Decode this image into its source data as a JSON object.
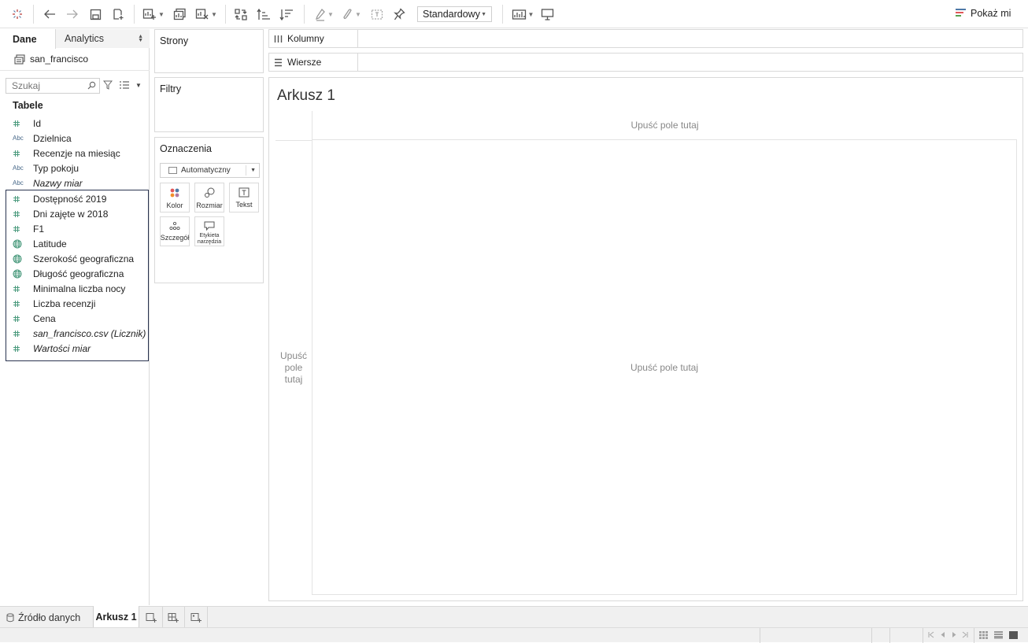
{
  "toolbar": {
    "format_value": "Standardowy",
    "show_me_label": "Pokaż mi",
    "icons": [
      "tableau-logo-icon",
      "undo-icon",
      "redo-icon",
      "save-icon",
      "new-datasource-icon",
      "new-worksheet-icon",
      "duplicate-icon",
      "clear-sheet-icon",
      "swap-icon",
      "sort-ascending-icon",
      "sort-descending-icon",
      "highlight-icon",
      "group-icon",
      "labels-icon",
      "pin-icon",
      "fit-icon",
      "presentation-icon",
      "show-me-icon"
    ]
  },
  "data_pane": {
    "tab_data": "Dane",
    "tab_analytics": "Analytics",
    "datasource_name": "san_francisco",
    "search_placeholder": "Szukaj",
    "tables_heading": "Tabele",
    "dimensions": [
      {
        "type": "number",
        "label": "Id"
      },
      {
        "type": "string",
        "label": "Dzielnica"
      },
      {
        "type": "number",
        "label": "Recenzje na miesiąc"
      },
      {
        "type": "string",
        "label": "Typ pokoju"
      },
      {
        "type": "string",
        "label": "Nazwy miar",
        "italic": true
      }
    ],
    "measures": [
      {
        "type": "number",
        "label": "Dostępność 2019"
      },
      {
        "type": "number",
        "label": "Dni zajęte w 2018"
      },
      {
        "type": "number",
        "label": "F1"
      },
      {
        "type": "geo",
        "label": "Latitude"
      },
      {
        "type": "geo",
        "label": "Szerokość geograficzna"
      },
      {
        "type": "geo",
        "label": "Długość geograficzna"
      },
      {
        "type": "number",
        "label": "Minimalna liczba nocy"
      },
      {
        "type": "number",
        "label": "Liczba recenzji"
      },
      {
        "type": "number",
        "label": "Cena"
      },
      {
        "type": "number",
        "label": "san_francisco.csv (Licznik)",
        "italic": true
      },
      {
        "type": "number",
        "label": "Wartości miar",
        "italic": true
      }
    ],
    "abc_glyph": "Abc"
  },
  "cards": {
    "pages_title": "Strony",
    "filters_title": "Filtry",
    "marks_title": "Oznaczenia",
    "marks_type": "Automatyczny",
    "marks_buttons": {
      "color": "Kolor",
      "size": "Rozmiar",
      "text": "Tekst",
      "detail": "Szczegół",
      "tooltip_line1": "Etykieta",
      "tooltip_line2": "narzędzia"
    }
  },
  "shelves": {
    "columns_label": "Kolumny",
    "rows_label": "Wiersze"
  },
  "view": {
    "sheet_title": "Arkusz 1",
    "drop_top": "Upuść pole tutaj",
    "drop_left_1": "Upuść",
    "drop_left_2": "pole",
    "drop_left_3": "tutaj",
    "drop_main": "Upuść pole tutaj"
  },
  "sheet_tabs": {
    "data_source_label": "Źródło danych",
    "active_sheet": "Arkusz 1"
  },
  "colors": {
    "accent_green": "#4a9a7d",
    "measures_highlight": "#2a3450",
    "dimension_blue": "#4a6a8a"
  }
}
